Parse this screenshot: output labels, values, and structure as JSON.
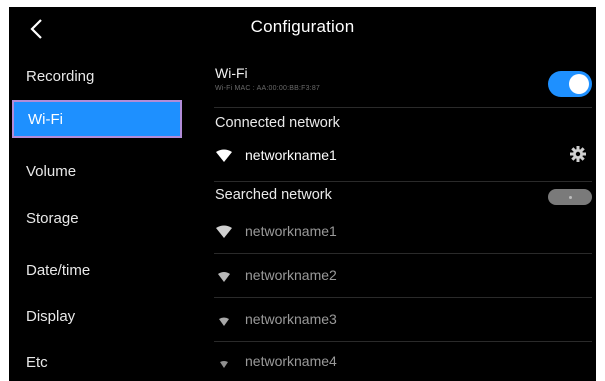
{
  "header": {
    "title": "Configuration",
    "back_icon": "chevron-left-icon"
  },
  "sidebar": {
    "items": [
      {
        "label": "Recording",
        "active": false
      },
      {
        "label": "Wi-Fi",
        "active": true
      },
      {
        "label": "Volume",
        "active": false
      },
      {
        "label": "Storage",
        "active": false
      },
      {
        "label": "Date/time",
        "active": false
      },
      {
        "label": "Display",
        "active": false
      },
      {
        "label": "Etc",
        "active": false
      }
    ]
  },
  "wifi": {
    "label": "Wi-Fi",
    "mac_text": "Wi-Fi MAC : AA:00:00:BB:F3:87",
    "enabled": true
  },
  "connected": {
    "heading": "Connected network",
    "network_name": "networkname1",
    "settings_icon": "gear-icon"
  },
  "searched": {
    "heading": "Searched network",
    "networks": [
      "networkname1",
      "networkname2",
      "networkname3",
      "networkname4"
    ]
  },
  "colors": {
    "accent": "#1e90ff",
    "active_border": "#b18cd8",
    "background": "#000000"
  }
}
